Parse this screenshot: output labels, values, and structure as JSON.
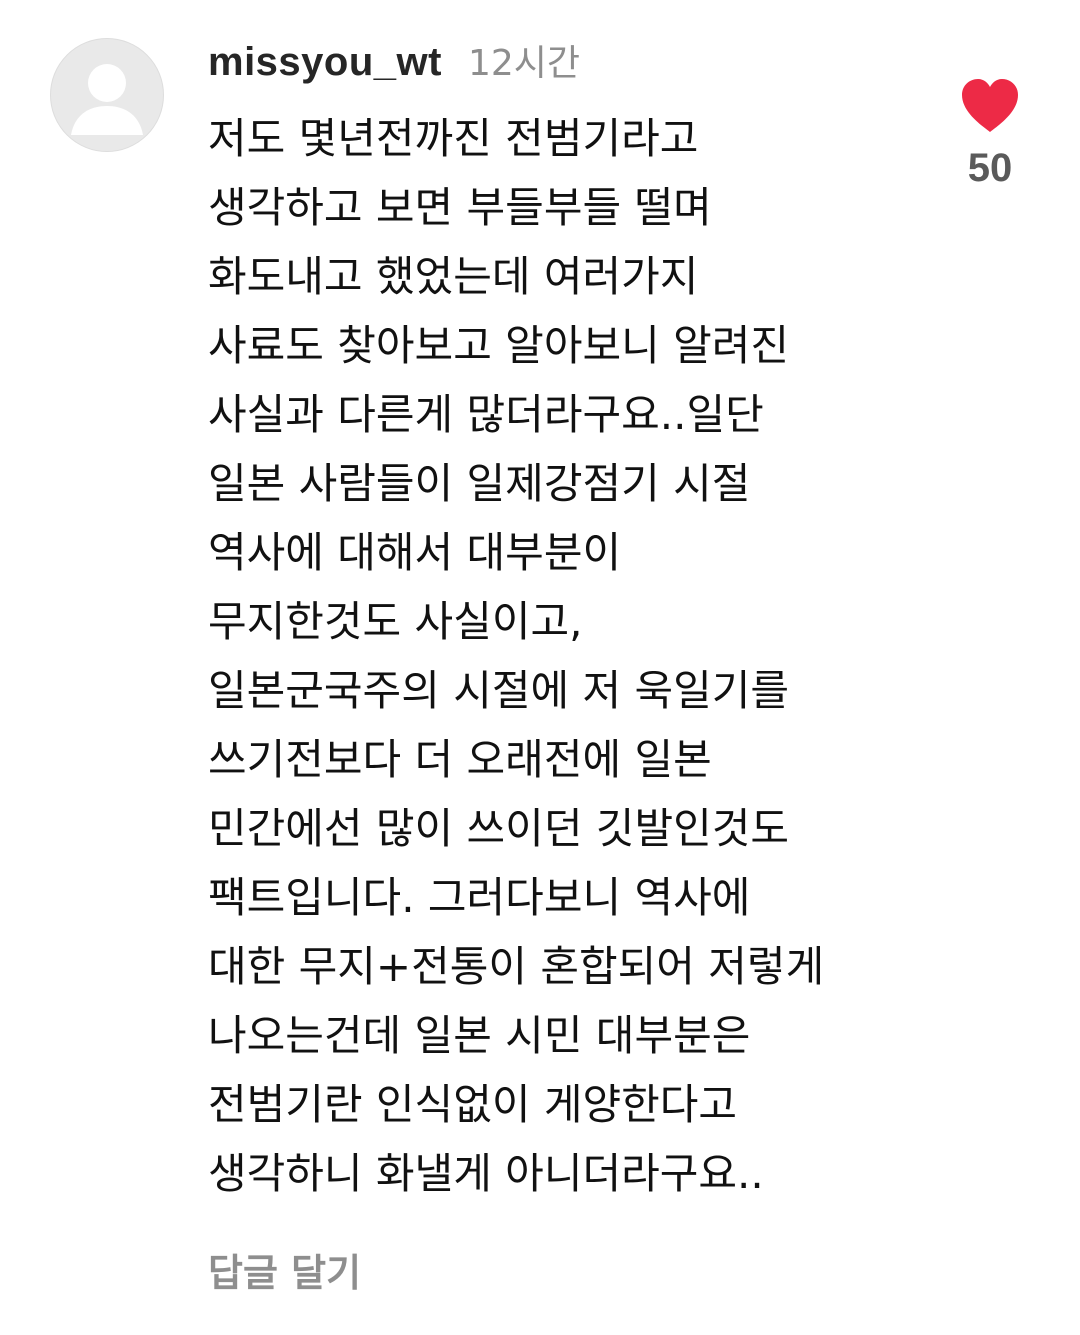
{
  "comment": {
    "username": "missyou_wt",
    "timestamp": "12시간",
    "avatar_icon": "default-user-avatar-icon",
    "lines": [
      "저도 몇년전까진 전범기라고",
      "생각하고 보면 부들부들 떨며",
      "화도내고 했었는데 여러가지",
      "사료도 찾아보고 알아보니 알려진",
      "사실과 다른게 많더라구요..일단",
      "일본 사람들이 일제강점기 시절",
      "역사에 대해서 대부분이",
      "무지한것도 사실이고,",
      "일본군국주의 시절에 저 욱일기를",
      "쓰기전보다 더 오래전에 일본",
      "민간에선 많이 쓰이던 깃발인것도",
      "팩트입니다. 그러다보니 역사에",
      "대한 무지+전통이 혼합되어 저렇게",
      "나오는건데 일본 시민 대부분은",
      "전범기란 인식없이 게양한다고",
      "생각하니 화낼게 아니더라구요.."
    ],
    "reply_label": "답글 달기"
  },
  "like": {
    "icon": "heart-icon",
    "count": "50",
    "liked": true,
    "color": "#ED2A46"
  },
  "colors": {
    "text": "#111111",
    "muted": "#8E8E8E",
    "like_count": "#5A5A5A",
    "avatar_bg": "#E9E9E9",
    "avatar_fg": "#FFFFFF"
  }
}
